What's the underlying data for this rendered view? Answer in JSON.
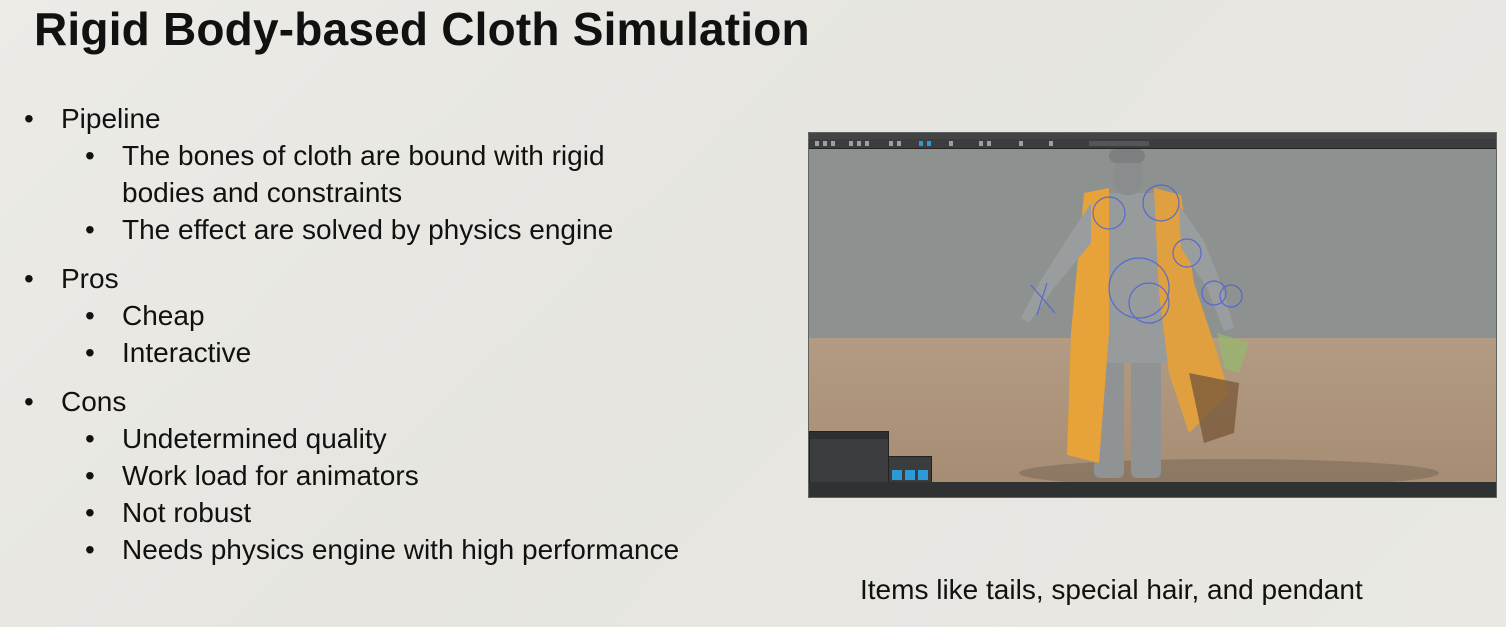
{
  "slide": {
    "title": "Rigid Body-based Cloth Simulation",
    "sections": [
      {
        "heading": "Pipeline",
        "items": [
          "The bones of cloth are bound with rigid",
          "bodies and constraints",
          "The effect are solved by physics engine"
        ]
      },
      {
        "heading": "Pros",
        "items": [
          "Cheap",
          "Interactive"
        ]
      },
      {
        "heading": "Cons",
        "items": [
          "Undetermined quality",
          "Work load for animators",
          "Not robust",
          "Needs physics engine with high performance"
        ]
      }
    ],
    "caption": "Items like tails, special hair, and pendant"
  },
  "viewport": {
    "background_color": "#8d918f",
    "ground_color": "#ab9278",
    "coat_color": "#e7a23a",
    "body_color": "#9a9d9e",
    "rig_color": "#4a62d8",
    "ui_accent_color": "#2d9ad8"
  }
}
